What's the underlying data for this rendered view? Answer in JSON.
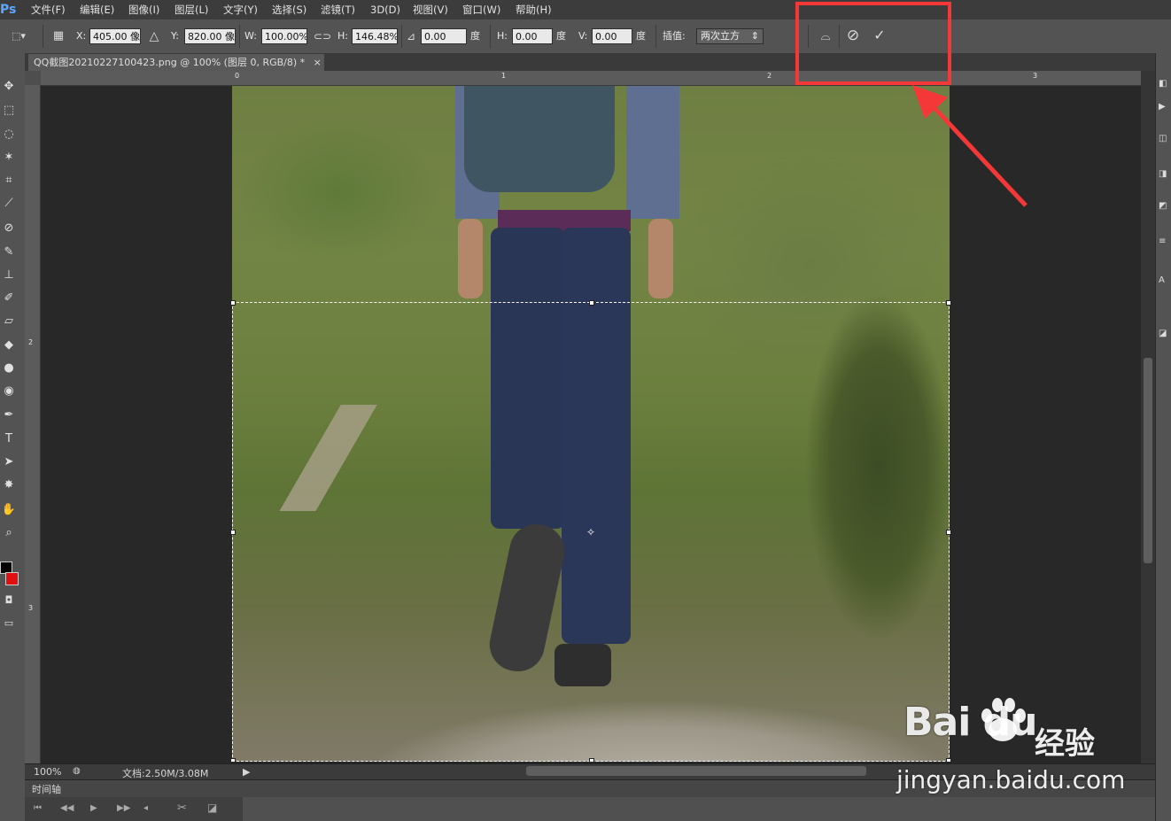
{
  "app": {
    "logo": "Ps"
  },
  "menu": [
    "文件(F)",
    "编辑(E)",
    "图像(I)",
    "图层(L)",
    "文字(Y)",
    "选择(S)",
    "滤镜(T)",
    "3D(D)",
    "视图(V)",
    "窗口(W)",
    "帮助(H)"
  ],
  "options": {
    "x_label": "X:",
    "x_value": "405.00 像:",
    "y_label": "Y:",
    "y_value": "820.00 像:",
    "w_label": "W:",
    "w_value": "100.00%",
    "h_label": "H:",
    "h_value": "146.48%",
    "angle_value": "0.00",
    "angle_unit": "度",
    "hskew_label": "H:",
    "hskew_value": "0.00",
    "hskew_unit": "度",
    "vskew_label": "V:",
    "vskew_value": "0.00",
    "vskew_unit": "度",
    "interp_label": "插值:",
    "interp_value": "两次立方"
  },
  "icons": {
    "warp": "warp-icon",
    "cancel": "cancel-transform-icon",
    "commit": "commit-transform-icon",
    "cancel_glyph": "⃠",
    "commit_glyph": "✓",
    "warp_glyph": "⌓"
  },
  "document": {
    "tab_title": "QQ截图20210227100423.png @ 100% (图层 0, RGB/8) *",
    "close": "×"
  },
  "rulers": {
    "top": [
      "0",
      "1",
      "2",
      "3"
    ],
    "left": [
      "2",
      "3"
    ]
  },
  "status": {
    "zoom": "100%",
    "doc_info": "文档:2.50M/3.08M"
  },
  "timeline": {
    "title": "时间轴"
  },
  "watermark": {
    "brand": "Bai du",
    "cn": "经验",
    "url": "jingyan.baidu.com"
  },
  "colors": {
    "highlight": "#f43838",
    "foreground": "#000000",
    "background": "#e01010"
  }
}
